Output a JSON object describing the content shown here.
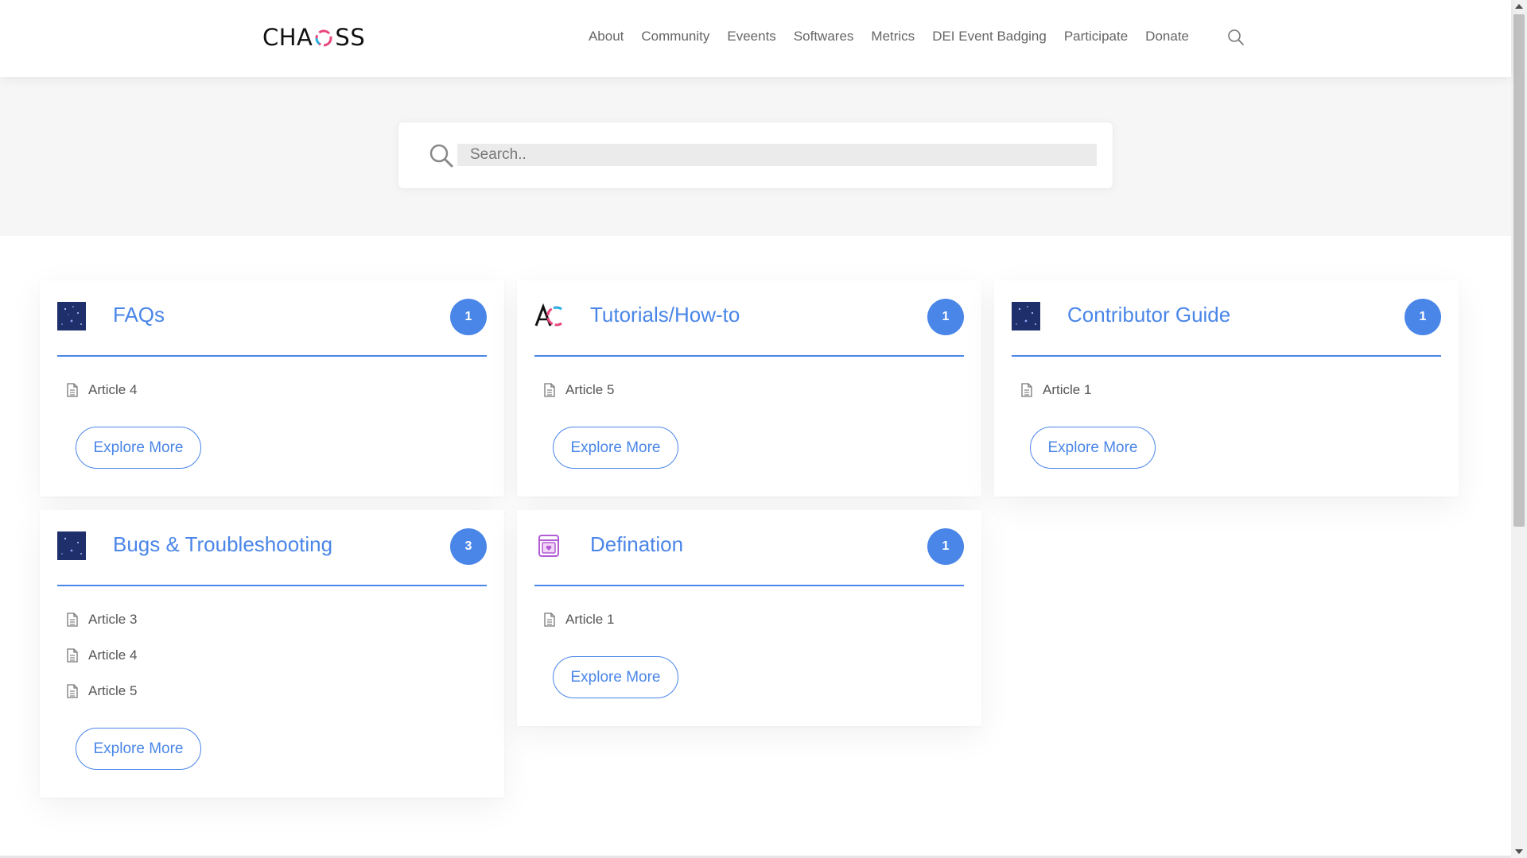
{
  "header": {
    "logo_prefix": "CHA",
    "logo_suffix": "SS",
    "nav": [
      "About",
      "Community",
      "Eveents",
      "Softwares",
      "Metrics",
      "DEI Event Badging",
      "Participate",
      "Donate"
    ]
  },
  "search": {
    "placeholder": "Search.."
  },
  "explore_label": "Explore More",
  "cards": [
    {
      "title": "FAQs",
      "count": "1",
      "icon": "galaxy-thumbnail",
      "articles": [
        "Article 4"
      ]
    },
    {
      "title": "Tutorials/How-to",
      "count": "1",
      "icon": "ac-logo-icon",
      "articles": [
        "Article 5"
      ]
    },
    {
      "title": "Contributor Guide",
      "count": "1",
      "icon": "galaxy-thumbnail",
      "articles": [
        "Article 1"
      ]
    },
    {
      "title": "Bugs & Troubleshooting",
      "count": "3",
      "icon": "galaxy-thumbnail",
      "articles": [
        "Article 3",
        "Article 4",
        "Article 5"
      ]
    },
    {
      "title": "Defination",
      "count": "1",
      "icon": "browser-heart-icon",
      "articles": [
        "Article 1"
      ]
    }
  ],
  "colors": {
    "accent": "#4a86e8"
  }
}
